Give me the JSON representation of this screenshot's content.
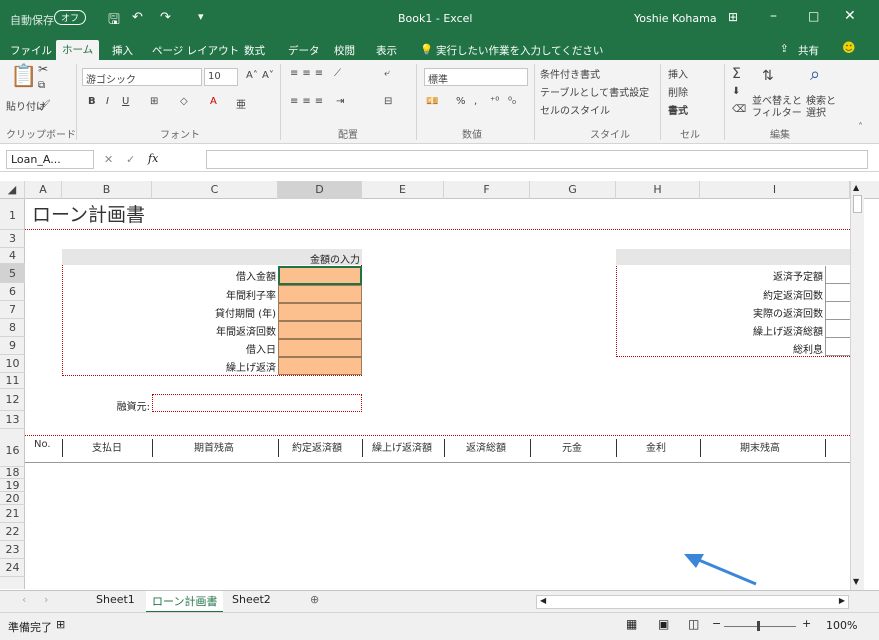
{
  "titlebar": {
    "autosave": "自動保存",
    "autosave_state": "オフ",
    "doc_title": "Book1 - Excel",
    "user": "Yoshie Kohama"
  },
  "tabs": [
    "ファイル",
    "ホーム",
    "挿入",
    "ページ レイアウト",
    "数式",
    "データ",
    "校閲",
    "表示"
  ],
  "tell_me": "実行したい作業を入力してください",
  "share": "共有",
  "ribbon": {
    "paste": "貼り付け",
    "font_name": "游ゴシック",
    "font_size": "10",
    "number_format": "標準",
    "conditional": "条件付き書式",
    "table_format": "テーブルとして書式設定",
    "cell_style": "セルのスタイル",
    "insert": "挿入",
    "delete": "削除",
    "format": "書式",
    "sort_filter": "並べ替えと\nフィルター",
    "find_select": "検索と\n選択",
    "groups": [
      "クリップボード",
      "フォント",
      "配置",
      "数値",
      "スタイル",
      "セル",
      "編集"
    ]
  },
  "namebox": "Loan_A...",
  "fx_label": "fx",
  "columns": [
    "A",
    "B",
    "C",
    "D",
    "E",
    "F",
    "G",
    "H",
    "I"
  ],
  "rows": [
    "1",
    "3",
    "4",
    "5",
    "6",
    "7",
    "8",
    "9",
    "10",
    "11",
    "12",
    "13",
    "16",
    "18",
    "19",
    "20",
    "21",
    "22",
    "23",
    "24"
  ],
  "sheet": {
    "title": "ローン計画書",
    "input_header": "金額の入力",
    "input_labels": [
      "借入金額",
      "年間利子率",
      "貸付期間 (年)",
      "年間返済回数",
      "借入日",
      "繰上げ返済"
    ],
    "lender_label": "融資元:",
    "summary_labels": [
      "返済予定額",
      "約定返済回数",
      "実際の返済回数",
      "繰上げ返済総額",
      "総利息"
    ],
    "table_headers": [
      "No.",
      "支払日",
      "期首残高",
      "約定返済額",
      "繰上げ返済額",
      "返済総額",
      "元金",
      "金利",
      "期末残高"
    ]
  },
  "sheet_tabs": [
    "Sheet1",
    "ローン計画書",
    "Sheet2"
  ],
  "status": {
    "ready": "準備完了",
    "zoom": "100%"
  },
  "colors": {
    "excel_green": "#217346",
    "input_fill": "#fcc08f",
    "border_red": "#c00000"
  }
}
